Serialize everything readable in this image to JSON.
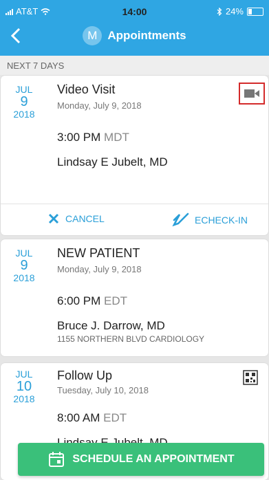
{
  "status": {
    "carrier": "AT&T",
    "time": "14:00",
    "battery": "24%"
  },
  "header": {
    "title": "Appointments",
    "avatar_letter": "M"
  },
  "section_label": "NEXT 7 DAYS",
  "appointments": [
    {
      "month": "JUL",
      "day": "9",
      "year": "2018",
      "type": "Video Visit",
      "date_long": "Monday, July 9, 2018",
      "time": "3:00 PM",
      "tz": "MDT",
      "provider": "Lindsay E Jubelt, MD",
      "cancel_label": "CANCEL",
      "echeckin_label": "ECHECK-IN"
    },
    {
      "month": "JUL",
      "day": "9",
      "year": "2018",
      "type": "NEW PATIENT",
      "date_long": "Monday, July 9, 2018",
      "time": "6:00 PM",
      "tz": "EDT",
      "provider": "Bruce J. Darrow, MD",
      "location": "1155 NORTHERN BLVD CARDIOLOGY"
    },
    {
      "month": "JUL",
      "day": "10",
      "year": "2018",
      "type": "Follow Up",
      "date_long": "Tuesday, July 10, 2018",
      "time": "8:00 AM",
      "tz": "EDT",
      "provider": "Lindsay E Jubelt, MD"
    }
  ],
  "schedule_button": "SCHEDULE AN APPOINTMENT",
  "colors": {
    "header": "#2fa6e3",
    "accent": "#2a9fd8",
    "button": "#3ac07a",
    "highlight": "#d32a2a"
  }
}
